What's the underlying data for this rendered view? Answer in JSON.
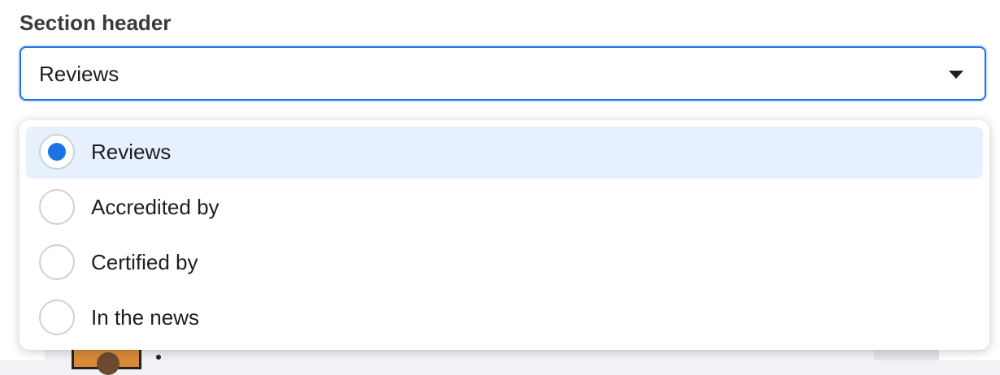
{
  "section": {
    "label": "Section header"
  },
  "select": {
    "value": "Reviews",
    "caret_icon": "caret-down-icon"
  },
  "menu": {
    "options": [
      {
        "label": "Reviews",
        "selected": true
      },
      {
        "label": "Accredited by",
        "selected": false
      },
      {
        "label": "Certified by",
        "selected": false
      },
      {
        "label": "In the news",
        "selected": false
      }
    ]
  },
  "colors": {
    "accent": "#1b74e4",
    "selected_bg": "#e7f0fd",
    "radio_border": "#ced0d4"
  }
}
